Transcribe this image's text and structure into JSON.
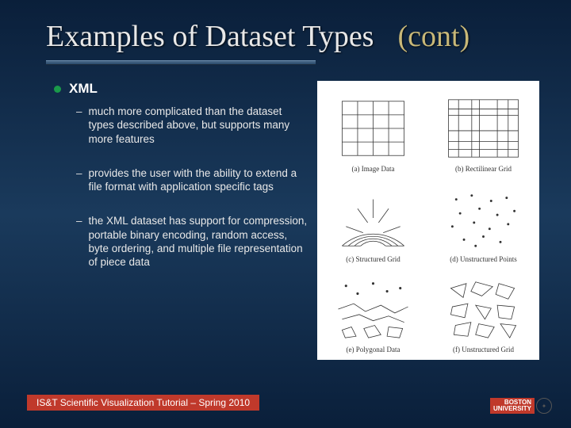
{
  "title": {
    "main": "Examples of Dataset Types",
    "cont": "(cont)"
  },
  "bullet": {
    "heading": "XML",
    "items": [
      "much more complicated than the dataset types described above, but supports many more features",
      "provides the user with the ability to extend a file format with application specific tags",
      "the XML dataset has support for compression, portable binary encoding, random access, byte ordering, and multiple file representation of piece data"
    ]
  },
  "figure": {
    "captions": [
      "(a) Image Data",
      "(b) Rectilinear Grid",
      "(c) Structured Grid",
      "(d) Unstructured Points",
      "(e) Polygonal Data",
      "(f) Unstructured Grid"
    ]
  },
  "footer": "IS&T Scientific Visualization Tutorial – Spring 2010",
  "logo": {
    "line1": "BOSTON",
    "line2": "UNIVERSITY"
  }
}
